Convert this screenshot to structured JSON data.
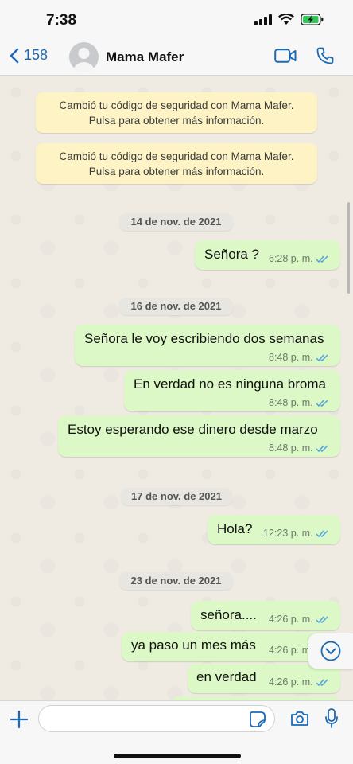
{
  "status": {
    "time": "7:38"
  },
  "header": {
    "back_count": "158",
    "contact_name": "Mama Mafer"
  },
  "system_notes": [
    {
      "line1": "Cambió tu código de seguridad con Mama Mafer.",
      "line2": "Pulsa para obtener más información."
    },
    {
      "line1": "Cambió tu código de seguridad con Mama Mafer.",
      "line2": "Pulsa para obtener más información."
    }
  ],
  "dates": [
    "14 de nov. de 2021",
    "16 de nov. de 2021",
    "17 de nov. de 2021",
    "23 de nov. de 2021"
  ],
  "messages": [
    {
      "text": "Señora ?",
      "time": "6:28 p. m."
    },
    {
      "text": "Señora le voy escribiendo dos semanas",
      "time": "8:48 p. m."
    },
    {
      "text": "En verdad no es ninguna broma",
      "time": "8:48 p. m."
    },
    {
      "text": "Estoy esperando ese dinero desde marzo",
      "time": "8:48 p. m."
    },
    {
      "text": "Hola?",
      "time": "12:23 p. m."
    },
    {
      "text": "señora....",
      "time": "4:26 p. m."
    },
    {
      "text": "ya paso un mes más",
      "time": "4:26 p. m"
    },
    {
      "text": "en verdad",
      "time": "4:26 p. m."
    }
  ],
  "input": {
    "value": "",
    "placeholder": ""
  },
  "colors": {
    "accent": "#1c6ab4",
    "outgoing_bubble": "#dcf8c6",
    "system_note": "#fdf3c5",
    "chat_bg": "#efeae2",
    "read_ticks": "#4fa3e0"
  },
  "icons": [
    "back-chevron-icon",
    "avatar-icon",
    "video-call-icon",
    "phone-icon",
    "double-check-icon",
    "scroll-down-icon",
    "plus-icon",
    "sticker-icon",
    "camera-icon",
    "microphone-icon"
  ]
}
